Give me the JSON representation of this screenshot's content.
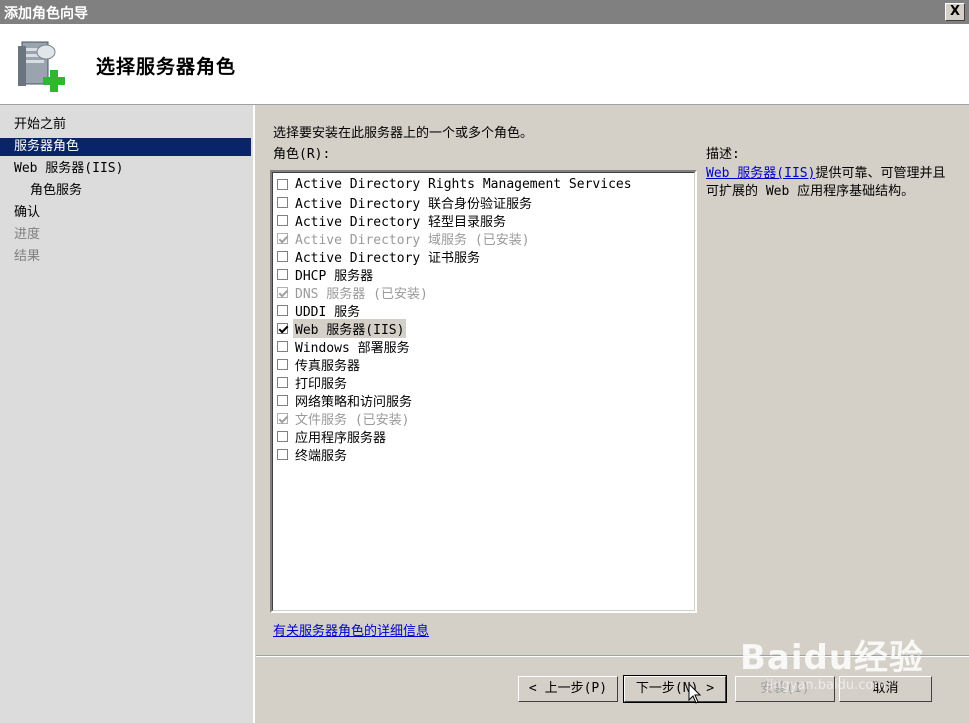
{
  "window": {
    "title": "添加角色向导",
    "close_glyph": "X"
  },
  "header": {
    "title": "选择服务器角色",
    "icon": "server-add-icon"
  },
  "nav": {
    "items": [
      {
        "label": "开始之前",
        "state": "normal"
      },
      {
        "label": "服务器角色",
        "state": "active"
      },
      {
        "label": "Web 服务器(IIS)",
        "state": "normal"
      },
      {
        "label": "角色服务",
        "state": "sub"
      },
      {
        "label": "确认",
        "state": "normal"
      },
      {
        "label": "进度",
        "state": "disabled"
      },
      {
        "label": "结果",
        "state": "disabled"
      }
    ]
  },
  "main": {
    "instruction": "选择要安装在此服务器上的一个或多个角色。",
    "roles_label": "角色(R):",
    "roles": [
      {
        "label": "Active Directory Rights Management Services",
        "checked": false,
        "disabled": false
      },
      {
        "label": "Active Directory 联合身份验证服务",
        "checked": false,
        "disabled": false
      },
      {
        "label": "Active Directory 轻型目录服务",
        "checked": false,
        "disabled": false
      },
      {
        "label": "Active Directory 域服务  (已安装)",
        "checked": true,
        "disabled": true
      },
      {
        "label": "Active Directory 证书服务",
        "checked": false,
        "disabled": false
      },
      {
        "label": "DHCP 服务器",
        "checked": false,
        "disabled": false
      },
      {
        "label": "DNS 服务器  (已安装)",
        "checked": true,
        "disabled": true
      },
      {
        "label": "UDDI 服务",
        "checked": false,
        "disabled": false
      },
      {
        "label": "Web 服务器(IIS)",
        "checked": true,
        "disabled": false,
        "selected": true
      },
      {
        "label": "Windows 部署服务",
        "checked": false,
        "disabled": false
      },
      {
        "label": "传真服务器",
        "checked": false,
        "disabled": false
      },
      {
        "label": "打印服务",
        "checked": false,
        "disabled": false
      },
      {
        "label": "网络策略和访问服务",
        "checked": false,
        "disabled": false
      },
      {
        "label": "文件服务  (已安装)",
        "checked": true,
        "disabled": true
      },
      {
        "label": "应用程序服务器",
        "checked": false,
        "disabled": false
      },
      {
        "label": "终端服务",
        "checked": false,
        "disabled": false
      }
    ],
    "more_info_link": "有关服务器角色的详细信息",
    "description_label": "描述:",
    "description_link": "Web 服务器(IIS)",
    "description_text": "提供可靠、可管理并且可扩展的 Web 应用程序基础结构。"
  },
  "buttons": {
    "back": "< 上一步(P)",
    "next": "下一步(N) >",
    "install": "安装(I)",
    "cancel": "取消"
  },
  "watermark": {
    "brand": "Baidu经验",
    "url": "jingyan.baidu.com"
  },
  "colors": {
    "active_nav": "#0a246a",
    "link": "#0000cc",
    "title_bar": "#808080"
  }
}
